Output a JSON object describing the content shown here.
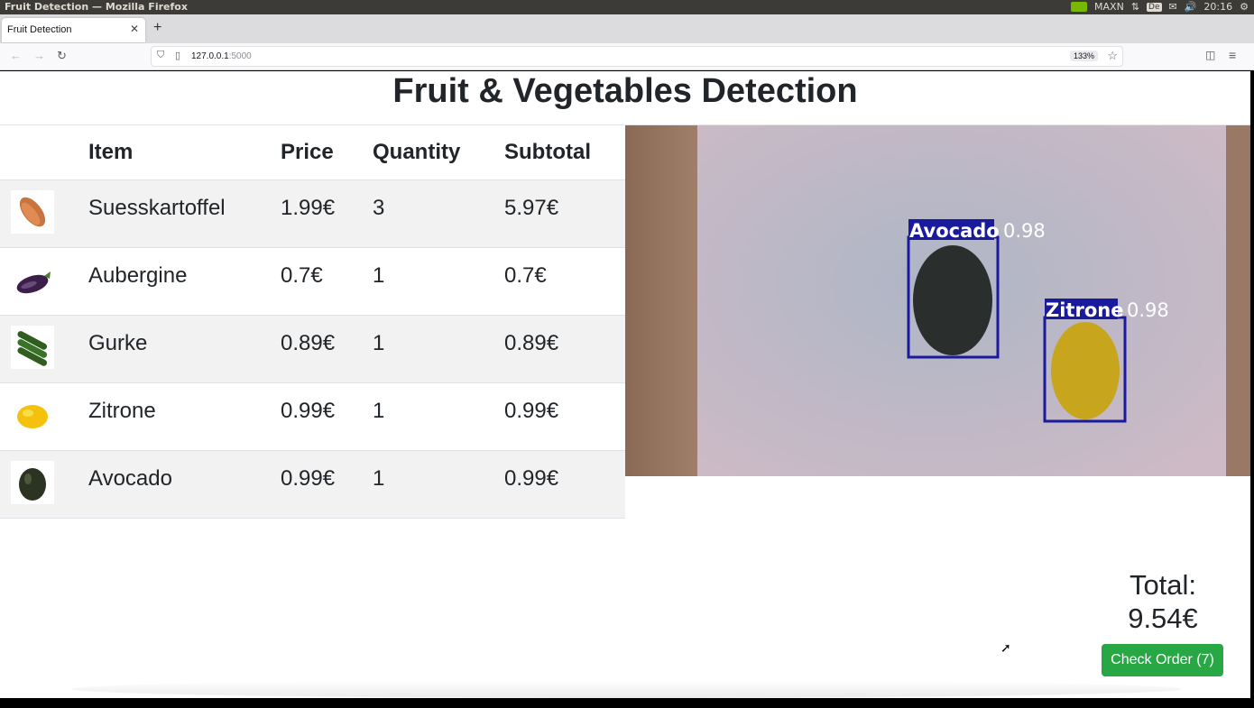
{
  "os": {
    "window_title": "Fruit Detection — Mozilla Firefox",
    "tray": {
      "power_mode": "MAXN",
      "keyboard": "De",
      "clock": "20:16"
    }
  },
  "browser": {
    "tab_title": "Fruit Detection",
    "url_host": "127.0.0.1",
    "url_port": ":5000",
    "zoom": "133%"
  },
  "page": {
    "title": "Fruit & Vegetables Detection",
    "table": {
      "headers": {
        "item": "Item",
        "price": "Price",
        "quantity": "Quantity",
        "subtotal": "Subtotal"
      },
      "rows": [
        {
          "item": "Suesskartoffel",
          "price": "1.99€",
          "quantity": "3",
          "subtotal": "5.97€"
        },
        {
          "item": "Aubergine",
          "price": "0.7€",
          "quantity": "1",
          "subtotal": "0.7€"
        },
        {
          "item": "Gurke",
          "price": "0.89€",
          "quantity": "1",
          "subtotal": "0.89€"
        },
        {
          "item": "Zitrone",
          "price": "0.99€",
          "quantity": "1",
          "subtotal": "0.99€"
        },
        {
          "item": "Avocado",
          "price": "0.99€",
          "quantity": "1",
          "subtotal": "0.99€"
        }
      ]
    },
    "detections": [
      {
        "label": "Avocado",
        "confidence": "0.98"
      },
      {
        "label": "Zitrone",
        "confidence": "0.98"
      }
    ],
    "total_label": "Total:",
    "total_value": "9.54€",
    "check_button": "Check Order (7)"
  },
  "colors": {
    "accent_green": "#28a745",
    "bbox_blue": "#1a1a9c"
  }
}
